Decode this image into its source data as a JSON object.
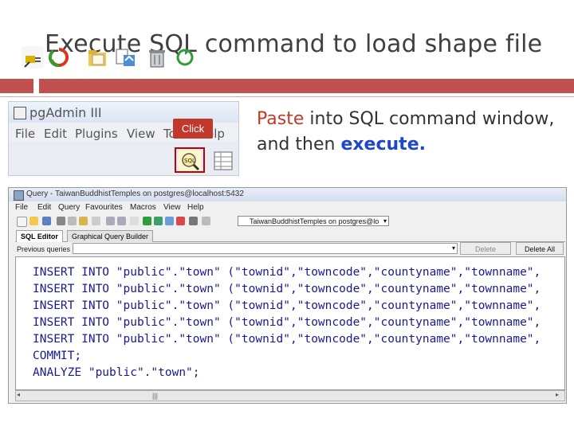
{
  "slide": {
    "title": "Execute SQL command to load shape file",
    "description": {
      "part1": "Paste",
      "part2": " into SQL command window, and then ",
      "part3": "execute."
    }
  },
  "pgadmin": {
    "title": "pgAdmin III",
    "menu": [
      "File",
      "Edit",
      "Plugins",
      "View",
      "To",
      "elp"
    ],
    "click_tag": "Click",
    "toolbar_icons": [
      "plug-icon",
      "refresh-icon",
      "folder-icon",
      "properties-icon",
      "trash-icon",
      "recycle-icon",
      "sql-icon",
      "grid-icon"
    ]
  },
  "query_window": {
    "title": "Query - TaiwanBuddhistTemples on postgres@localhost:5432",
    "menu": [
      "File",
      "Edit",
      "Query",
      "Favourites",
      "Macros",
      "View",
      "Help"
    ],
    "db_selector": "TaiwanBuddhistTemples on postgres@lo",
    "tabs": [
      "SQL Editor",
      "Graphical Query Builder"
    ],
    "previous_queries_label": "Previous queries",
    "delete_label": "Delete",
    "delete_all_label": "Delete All",
    "code": [
      "INSERT INTO \"public\".\"town\" (\"townid\",\"towncode\",\"countyname\",\"townname\",",
      "INSERT INTO \"public\".\"town\" (\"townid\",\"towncode\",\"countyname\",\"townname\",",
      "INSERT INTO \"public\".\"town\" (\"townid\",\"towncode\",\"countyname\",\"townname\",",
      "INSERT INTO \"public\".\"town\" (\"townid\",\"towncode\",\"countyname\",\"townname\",",
      "INSERT INTO \"public\".\"town\" (\"townid\",\"towncode\",\"countyname\",\"townname\",",
      "COMMIT;",
      "ANALYZE \"public\".\"town\";"
    ]
  },
  "colors": {
    "accent_red": "#c0504d",
    "highlight_red": "#c0392b",
    "highlight_blue": "#1f47c9"
  }
}
